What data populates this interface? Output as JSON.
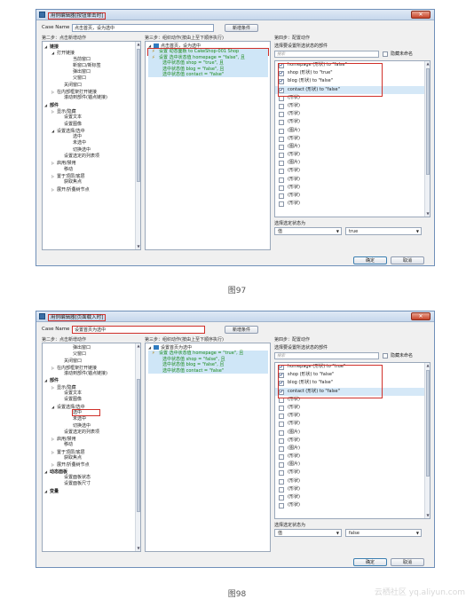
{
  "shot1": {
    "title": "用例编辑器[按钮单击时]",
    "case_name_label": "Case Name",
    "case_name_value": "点击首页，设为选中",
    "add_condition": "新增条件",
    "step2_label": "第二步：点击新增动作",
    "step3_label": "第三步：组织动作(按由上至下顺序执行)",
    "step4_label": "第四步：配置动作",
    "left_tree": [
      {
        "text": "链接",
        "level": 0,
        "toggle": "◢",
        "bold": true
      },
      {
        "text": "打开链接",
        "level": 1,
        "toggle": "◢"
      },
      {
        "text": "当前窗口",
        "level": 3
      },
      {
        "text": "新窗口/新标签",
        "level": 3
      },
      {
        "text": "弹出窗口",
        "level": 3
      },
      {
        "text": "父窗口",
        "level": 3
      },
      {
        "text": "关闭窗口",
        "level": 2
      },
      {
        "text": "在内部框架打开链接",
        "level": 1,
        "toggle": "▷"
      },
      {
        "text": "滚动到部件(锚点链接)",
        "level": 2
      },
      {
        "text": "部件",
        "level": 0,
        "toggle": "◢",
        "bold": true
      },
      {
        "text": "显示/隐藏",
        "level": 1,
        "toggle": "▷"
      },
      {
        "text": "设置文本",
        "level": 2
      },
      {
        "text": "设置图像",
        "level": 2
      },
      {
        "text": "设置选择/选中",
        "level": 1,
        "toggle": "◢"
      },
      {
        "text": "选中",
        "level": 3
      },
      {
        "text": "未选中",
        "level": 3
      },
      {
        "text": "切换选中",
        "level": 3
      },
      {
        "text": "设置选定的列表项",
        "level": 2
      },
      {
        "text": "启用/禁用",
        "level": 1,
        "toggle": "▷"
      },
      {
        "text": "移动",
        "level": 2
      },
      {
        "text": "置于顶层/底层",
        "level": 1,
        "toggle": "▷"
      },
      {
        "text": "获取焦点",
        "level": 2
      },
      {
        "text": "展开/折叠树节点",
        "level": 1,
        "toggle": "▷"
      }
    ],
    "mid_case": "点击首页，设为选中",
    "mid_actions": [
      {
        "lines": [
          "设置 动态面板 to CakeShop-001 Shop"
        ],
        "boxed": true
      },
      {
        "lines": [
          "设置 选中状态值 homepage = \"false\", 且",
          "选中状态值 shop = \"true\", 且",
          "选中状态值 blog = \"false\", 且",
          "选中状态值 contact = \"false\""
        ],
        "boxed": false
      }
    ],
    "select_widgets_label": "选择要设置所选状态的部件",
    "search_placeholder": "搜索",
    "hide_unnamed": "隐藏未命名",
    "widgets": [
      {
        "text": "homepage (形状) to \"false\"",
        "checked": true,
        "sel": false
      },
      {
        "text": "shop (形状) to \"true\"",
        "checked": true,
        "sel": false
      },
      {
        "text": "blog (形状) to \"false\"",
        "checked": true,
        "sel": false
      },
      {
        "text": "contact (形状) to \"false\"",
        "checked": true,
        "sel": true
      },
      {
        "text": "(形状)",
        "checked": false
      },
      {
        "text": "(形状)",
        "checked": false
      },
      {
        "text": "(形状)",
        "checked": false
      },
      {
        "text": "(形状)",
        "checked": false
      },
      {
        "text": "(图片)",
        "checked": false
      },
      {
        "text": "(形状)",
        "checked": false
      },
      {
        "text": "(图片)",
        "checked": false
      },
      {
        "text": "(形状)",
        "checked": false
      },
      {
        "text": "(图片)",
        "checked": false
      },
      {
        "text": "(形状)",
        "checked": false
      },
      {
        "text": "(形状)",
        "checked": false
      },
      {
        "text": "(形状)",
        "checked": false
      },
      {
        "text": "(形状)",
        "checked": false
      },
      {
        "text": "(形状)",
        "checked": false
      }
    ],
    "set_selected_label": "选择选定状态为",
    "value_dd": "值",
    "value_choice": "true",
    "ok": "确定",
    "cancel": "取消",
    "caption": "图97"
  },
  "shot2": {
    "title": "用例编辑器[页面载入时]",
    "case_name_label": "Case Name",
    "case_name_value": "设置首页为选中",
    "add_condition": "新增条件",
    "step2_label": "第二步：点击新增动作",
    "step3_label": "第三步：组织动作(按由上至下顺序执行)",
    "step4_label": "第四步：配置动作",
    "left_tree": [
      {
        "text": "弹出窗口",
        "level": 3
      },
      {
        "text": "父窗口",
        "level": 3
      },
      {
        "text": "关闭窗口",
        "level": 2
      },
      {
        "text": "在内部框架打开链接",
        "level": 1,
        "toggle": "▷"
      },
      {
        "text": "滚动到部件(锚点链接)",
        "level": 2
      },
      {
        "text": "部件",
        "level": 0,
        "toggle": "◢",
        "bold": true
      },
      {
        "text": "显示/隐藏",
        "level": 1,
        "toggle": "▷"
      },
      {
        "text": "设置文本",
        "level": 2
      },
      {
        "text": "设置图像",
        "level": 2
      },
      {
        "text": "设置选择/选中",
        "level": 1,
        "toggle": "◢"
      },
      {
        "text": "选中",
        "level": 3,
        "boxed": true
      },
      {
        "text": "未选中",
        "level": 3
      },
      {
        "text": "切换选中",
        "level": 3
      },
      {
        "text": "设置选定的列表项",
        "level": 2
      },
      {
        "text": "启用/禁用",
        "level": 1,
        "toggle": "▷"
      },
      {
        "text": "移动",
        "level": 2
      },
      {
        "text": "置于顶层/底层",
        "level": 1,
        "toggle": "▷"
      },
      {
        "text": "获取焦点",
        "level": 2
      },
      {
        "text": "展开/折叠树节点",
        "level": 1,
        "toggle": "▷"
      },
      {
        "text": "动态面板",
        "level": 0,
        "toggle": "◢",
        "bold": true
      },
      {
        "text": "设置面板状态",
        "level": 2
      },
      {
        "text": "设置面板尺寸",
        "level": 2
      },
      {
        "text": "变量",
        "level": 0,
        "toggle": "◢",
        "bold": true
      }
    ],
    "mid_case": "设置首页为选中",
    "mid_actions": [
      {
        "lines": [
          "设置 选中状态值 homepage = \"true\", 且",
          "选中状态值 shop = \"false\", 且",
          "选中状态值 blog = \"false\", 且",
          "选中状态值 contact = \"false\""
        ],
        "boxed": false
      }
    ],
    "select_widgets_label": "选择要设置所选状态的部件",
    "search_placeholder": "搜索",
    "hide_unnamed": "隐藏未命名",
    "widgets": [
      {
        "text": "homepage (形状) to \"true\"",
        "checked": true,
        "sel": false
      },
      {
        "text": "shop (形状) to \"false\"",
        "checked": true,
        "sel": false
      },
      {
        "text": "blog (形状) to \"false\"",
        "checked": true,
        "sel": false
      },
      {
        "text": "contact (形状) to \"false\"",
        "checked": true,
        "sel": true
      },
      {
        "text": "(形状)",
        "checked": false
      },
      {
        "text": "(形状)",
        "checked": false
      },
      {
        "text": "(形状)",
        "checked": false
      },
      {
        "text": "(形状)",
        "checked": false
      },
      {
        "text": "(图片)",
        "checked": false
      },
      {
        "text": "(形状)",
        "checked": false
      },
      {
        "text": "(图片)",
        "checked": false
      },
      {
        "text": "(形状)",
        "checked": false
      },
      {
        "text": "(图片)",
        "checked": false
      },
      {
        "text": "(形状)",
        "checked": false
      },
      {
        "text": "(形状)",
        "checked": false
      },
      {
        "text": "(形状)",
        "checked": false
      },
      {
        "text": "(形状)",
        "checked": false
      },
      {
        "text": "(形状)",
        "checked": false
      }
    ],
    "set_selected_label": "选择选定状态为",
    "value_dd": "值",
    "value_choice": "false",
    "ok": "确定",
    "cancel": "取消",
    "caption": "图98"
  },
  "watermark": "云栖社区 yq.aliyun.com"
}
